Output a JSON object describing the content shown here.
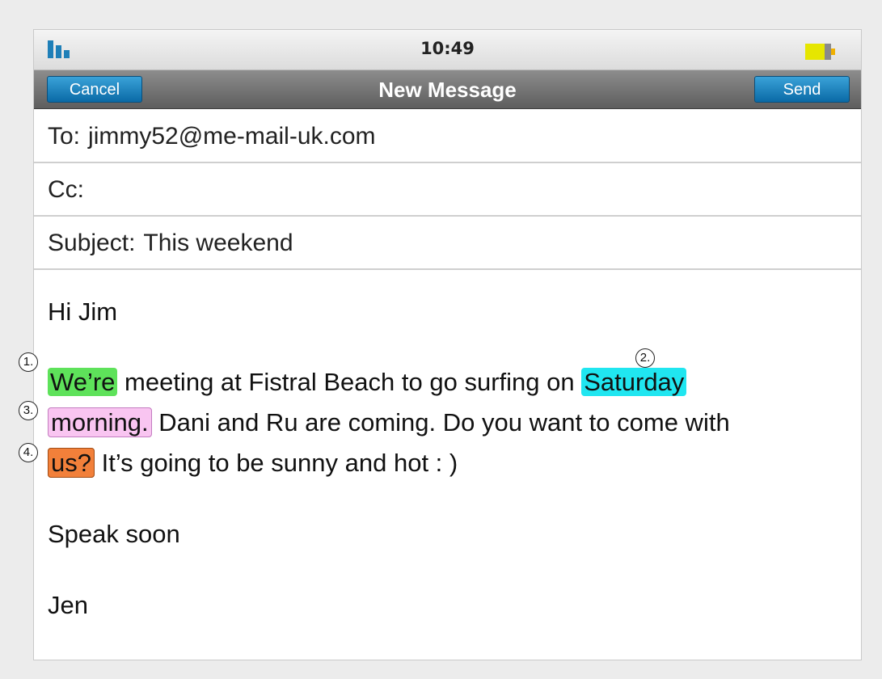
{
  "status_bar": {
    "time": "10:49",
    "battery_level": 0.75,
    "signal_bars": 3,
    "accent_color": "#1e7fb8"
  },
  "nav": {
    "cancel_label": "Cancel",
    "title": "New Message",
    "send_label": "Send"
  },
  "fields": {
    "to_label": "To:",
    "to_value": "jimmy52@me-mail-uk.com",
    "cc_label": "Cc:",
    "subject_label": "Subject:",
    "subject_value": "This weekend"
  },
  "message": {
    "greeting": "Hi Jim",
    "line1": {
      "highlight1": "We’re",
      "text1": " meeting at Fistral Beach to go surfing on ",
      "highlight2": "Saturday"
    },
    "line2": {
      "highlight3": "morning.",
      "text": " Dani and Ru are coming. Do you want to come with"
    },
    "line3": {
      "highlight4": "us?",
      "text": " It’s going to be sunny and hot : )"
    },
    "closing": "Speak soon",
    "signature": "Jen"
  },
  "markers": [
    "1.",
    "2.",
    "3.",
    "4."
  ],
  "highlight_colors": {
    "green": "#5ee25a",
    "cyan": "#20e6f0",
    "pink": "#f9c5f1",
    "orange": "#f2803a"
  }
}
